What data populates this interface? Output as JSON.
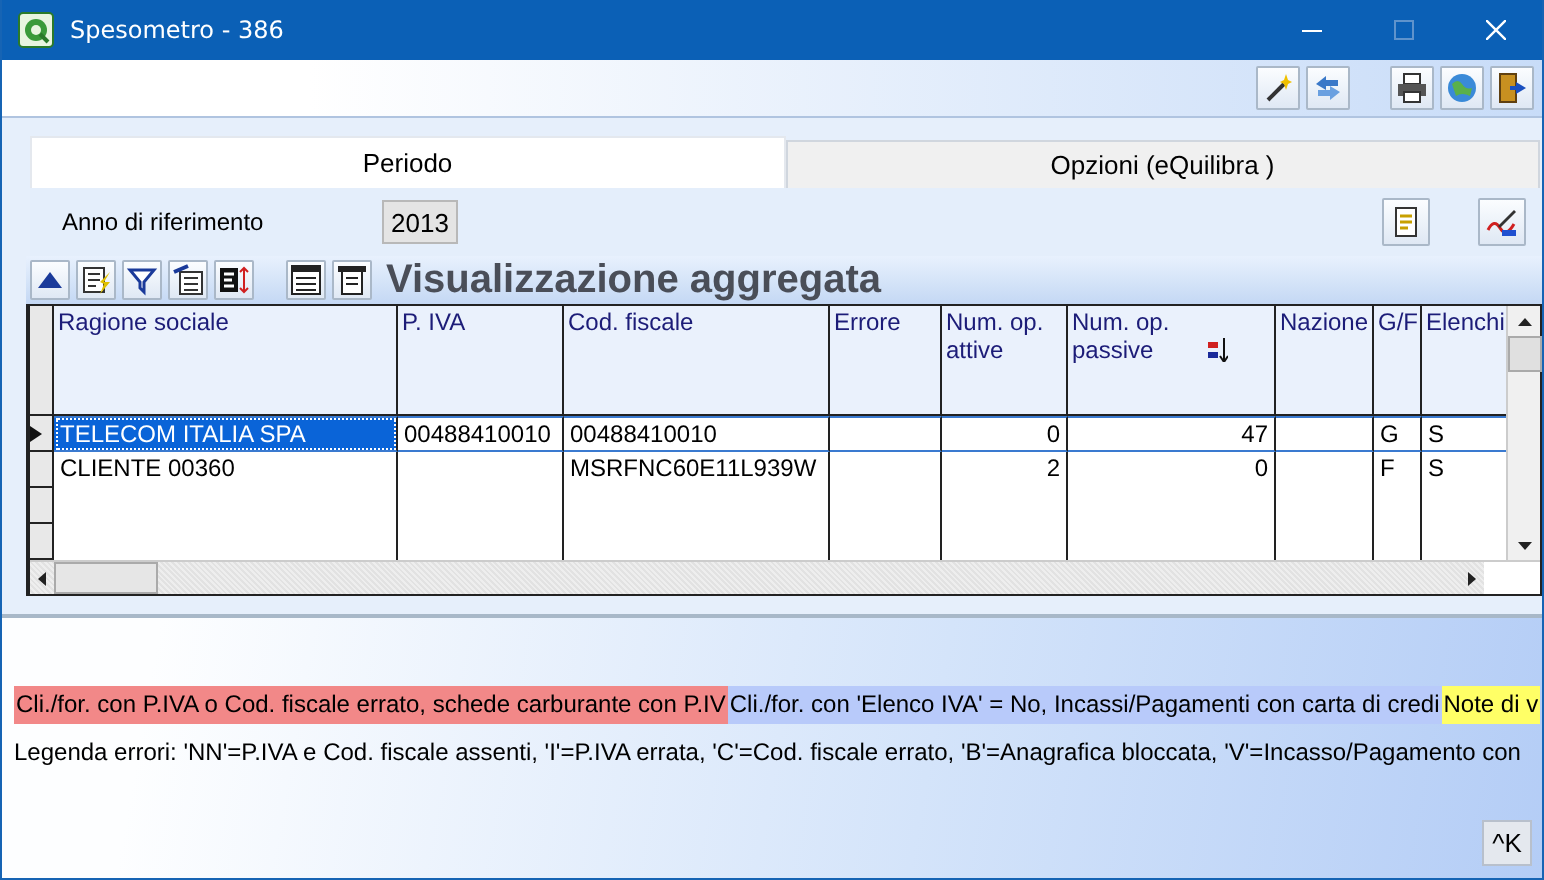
{
  "window": {
    "title": "Spesometro - 386"
  },
  "tabs": [
    {
      "label": "Periodo",
      "selected": true
    },
    {
      "label": "Opzioni (eQuilibra )",
      "selected": false
    }
  ],
  "period": {
    "label": "Anno di riferimento",
    "year": "2013"
  },
  "grid": {
    "title": "Visualizzazione aggregata",
    "columns": [
      {
        "label": "Ragione sociale",
        "kind": "text",
        "sorted": false
      },
      {
        "label": "P. IVA",
        "kind": "text",
        "sorted": false
      },
      {
        "label": "Cod. fiscale",
        "kind": "text",
        "sorted": false
      },
      {
        "label": "Errore",
        "kind": "text",
        "sorted": false
      },
      {
        "label": "Num. op. attive",
        "kind": "number",
        "sorted": false
      },
      {
        "label": "Num. op. passive",
        "kind": "number",
        "sorted": true
      },
      {
        "label": "Nazione",
        "kind": "text",
        "sorted": false
      },
      {
        "label": "G/F",
        "kind": "text",
        "sorted": false
      },
      {
        "label": "Elenchi",
        "kind": "text",
        "sorted": false
      }
    ],
    "rows": [
      {
        "selected": true,
        "cells": [
          "TELECOM ITALIA SPA",
          "00488410010",
          "00488410010",
          "",
          "0",
          "47",
          "",
          "G",
          "S"
        ]
      },
      {
        "selected": false,
        "cells": [
          "CLIENTE 00360",
          "",
          "MSRFNC60E11L939W",
          "",
          "2",
          "0",
          "",
          "F",
          "S"
        ]
      }
    ]
  },
  "legend": {
    "segments": [
      {
        "text": "Cli./for. con P.IVA o Cod. fiscale errato, schede carburante con P.IV",
        "color": "#f28888"
      },
      {
        "text": "Cli./for. con 'Elenco IVA' = No, Incassi/Pagamenti con carta di credi",
        "color": "#b8cafa"
      },
      {
        "text": "Note di v",
        "color": "#ffff66"
      }
    ],
    "note": "Legenda errori: 'NN'=P.IVA e Cod. fiscale assenti, 'I'=P.IVA errata, 'C'=Cod. fiscale errato, 'B'=Anagrafica bloccata, 'V'=Incasso/Pagamento con"
  },
  "shortcut_button": "^K"
}
